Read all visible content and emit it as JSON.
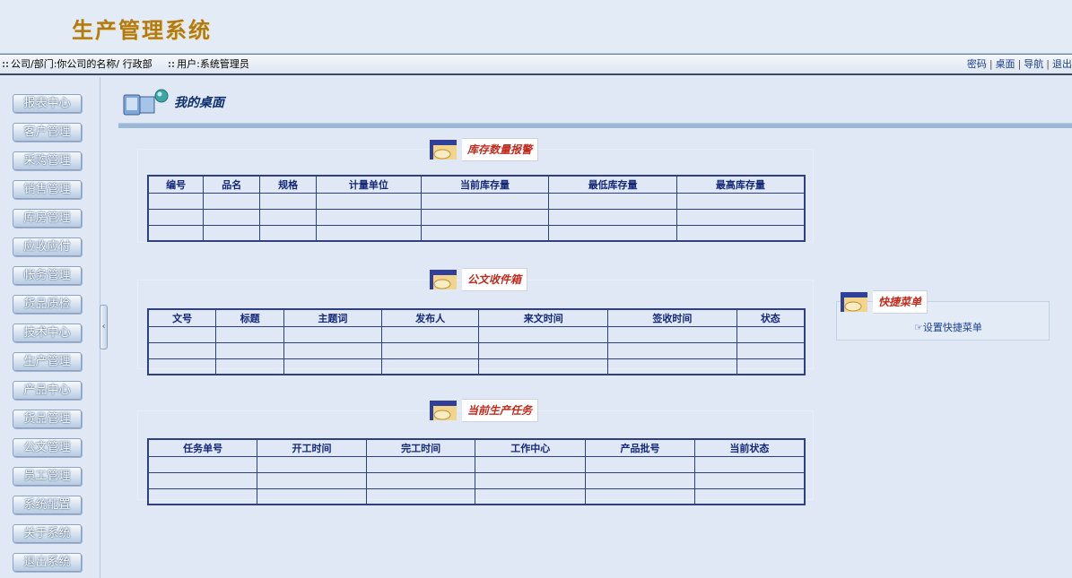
{
  "app": {
    "title": "生产管理系统"
  },
  "infobar": {
    "company_label": "公司/部门:",
    "company_value": "你公司的名称/ 行政部",
    "user_label": "用户:",
    "user_value": "系统管理员",
    "links": [
      "密码",
      "桌面",
      "导航",
      "退出"
    ]
  },
  "sidebar": {
    "items": [
      {
        "label": "报表中心"
      },
      {
        "label": "客户管理"
      },
      {
        "label": "采购管理"
      },
      {
        "label": "销售管理"
      },
      {
        "label": "库房管理"
      },
      {
        "label": "应收应付"
      },
      {
        "label": "帐务管理"
      },
      {
        "label": "货品质检"
      },
      {
        "label": "技术中心"
      },
      {
        "label": "生产管理"
      },
      {
        "label": "产品中心"
      },
      {
        "label": "货品管理"
      },
      {
        "label": "公文管理"
      },
      {
        "label": "员工管理"
      },
      {
        "label": "系统配置"
      },
      {
        "label": "关于系统"
      },
      {
        "label": "退出系统"
      }
    ]
  },
  "desk": {
    "title": "我的桌面"
  },
  "inventory": {
    "title": "库存数量报警",
    "columns": [
      "编号",
      "品名",
      "规格",
      "计量单位",
      "当前库存量",
      "最低库存量",
      "最高库存量"
    ]
  },
  "documents": {
    "title": "公文收件箱",
    "columns": [
      "文号",
      "标题",
      "主题词",
      "发布人",
      "来文时间",
      "签收时间",
      "状态"
    ]
  },
  "production": {
    "title": "当前生产任务",
    "columns": [
      "任务单号",
      "开工时间",
      "完工时间",
      "工作中心",
      "产品批号",
      "当前状态"
    ]
  },
  "quick": {
    "title": "快捷菜单",
    "link": "设置快捷菜单"
  }
}
